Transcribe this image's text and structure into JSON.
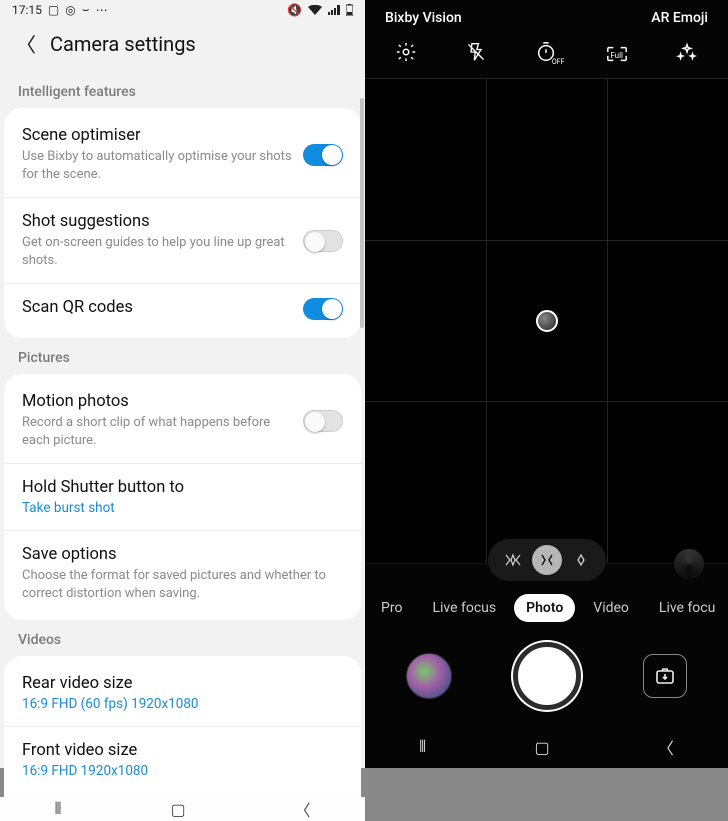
{
  "status": {
    "time": "17:15"
  },
  "header": {
    "title": "Camera settings"
  },
  "sections": {
    "intelligent": {
      "label": "Intelligent features",
      "scene": {
        "title": "Scene optimiser",
        "sub": "Use Bixby to automatically optimise your shots for the scene."
      },
      "shot": {
        "title": "Shot suggestions",
        "sub": "Get on-screen guides to help you line up great shots."
      },
      "qr": {
        "title": "Scan QR codes"
      }
    },
    "pictures": {
      "label": "Pictures",
      "motion": {
        "title": "Motion photos",
        "sub": "Record a short clip of what happens before each picture."
      },
      "hold": {
        "title": "Hold Shutter button to",
        "value": "Take burst shot"
      },
      "save": {
        "title": "Save options",
        "sub": "Choose the format for saved pictures and whether to correct distortion when saving."
      }
    },
    "videos": {
      "label": "Videos",
      "rear": {
        "title": "Rear video size",
        "value": "16:9 FHD (60 fps) 1920x1080"
      },
      "front": {
        "title": "Front video size",
        "value": "16:9 FHD 1920x1080"
      }
    }
  },
  "camera": {
    "top_left": "Bixby Vision",
    "top_right": "AR Emoji",
    "icons": {
      "settings": "gear-icon",
      "flash": "flash-off-icon",
      "timer": "timer-off-icon",
      "ratio": "ratio-full-icon",
      "filter": "filters-icon",
      "ratio_label": "Full"
    },
    "modes": [
      "Pro",
      "Live focus",
      "Photo",
      "Video",
      "Live focu"
    ],
    "selected_mode": "Photo"
  }
}
